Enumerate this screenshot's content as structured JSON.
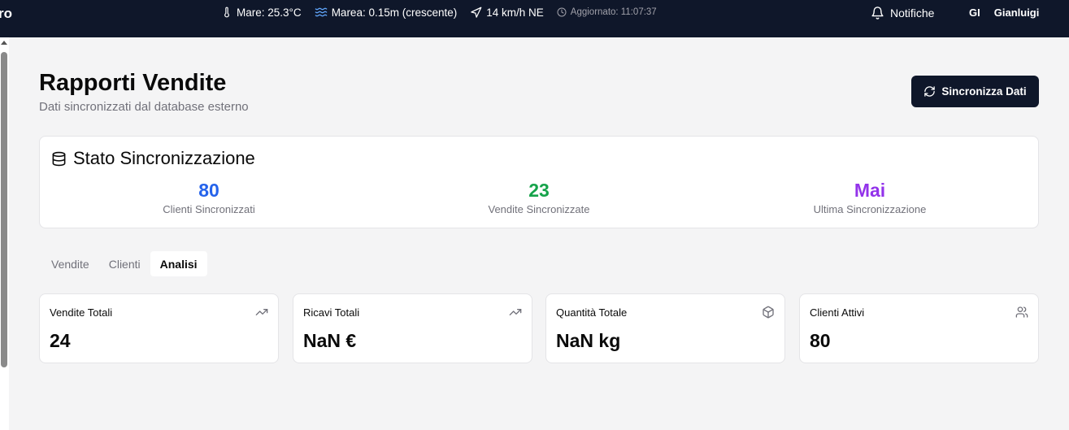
{
  "topbar": {
    "brand": "ro",
    "weather": {
      "sea": "Mare: 25.3°C",
      "tide": "Marea: 0.15m (crescente)",
      "wind": "14 km/h NE",
      "updated": "Aggiornato: 11:07:37"
    },
    "notifications": "Notifiche",
    "user": {
      "initials": "GI",
      "name": "Gianluigi"
    }
  },
  "header": {
    "title": "Rapporti Vendite",
    "subtitle": "Dati sincronizzati dal database esterno",
    "sync_button": "Sincronizza Dati"
  },
  "status": {
    "title": "Stato Sincronizzazione",
    "stats": [
      {
        "value": "80",
        "label": "Clienti Sincronizzati",
        "color": "#2563eb"
      },
      {
        "value": "23",
        "label": "Vendite Sincronizzate",
        "color": "#16a34a"
      },
      {
        "value": "Mai",
        "label": "Ultima Sincronizzazione",
        "color": "#9333ea"
      }
    ]
  },
  "tabs": [
    {
      "label": "Vendite",
      "active": false
    },
    {
      "label": "Clienti",
      "active": false
    },
    {
      "label": "Analisi",
      "active": true
    }
  ],
  "kpis": [
    {
      "label": "Vendite Totali",
      "value": "24",
      "icon": "trending-up-icon"
    },
    {
      "label": "Ricavi Totali",
      "value": "NaN €",
      "icon": "trending-up-icon"
    },
    {
      "label": "Quantità Totale",
      "value": "NaN kg",
      "icon": "package-icon"
    },
    {
      "label": "Clienti Attivi",
      "value": "80",
      "icon": "users-icon"
    }
  ]
}
